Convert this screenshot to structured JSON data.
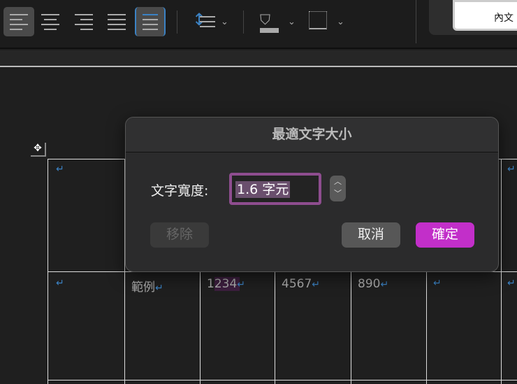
{
  "toolbar": {
    "style_preview": "內文"
  },
  "dialog": {
    "title": "最適文字大小",
    "width_label": "文字寬度:",
    "width_value": "1.6 字元",
    "remove_label": "移除",
    "cancel_label": "取消",
    "ok_label": "確定"
  },
  "table": {
    "row2": [
      "範例",
      "1234",
      "4567",
      "890"
    ],
    "return_mark": "↵"
  },
  "colors": {
    "accent": "#c22fc9",
    "focus": "#8e4d8f"
  }
}
